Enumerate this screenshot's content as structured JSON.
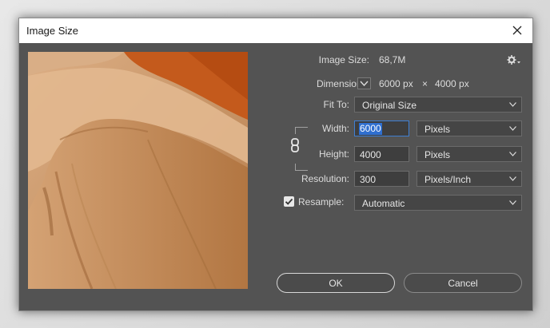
{
  "window": {
    "title": "Image Size"
  },
  "info": {
    "image_size_label": "Image Size:",
    "image_size_value": "68,7M",
    "dimensions_label": "Dimensions:",
    "dimensions_width": "6000 px",
    "dimensions_sep": "×",
    "dimensions_height": "4000 px"
  },
  "fit_to": {
    "label": "Fit To:",
    "value": "Original Size"
  },
  "width": {
    "label": "Width:",
    "value": "6000",
    "unit": "Pixels"
  },
  "height": {
    "label": "Height:",
    "value": "4000",
    "unit": "Pixels"
  },
  "resolution": {
    "label": "Resolution:",
    "value": "300",
    "unit": "Pixels/Inch"
  },
  "resample": {
    "label": "Resample:",
    "checked": true,
    "value": "Automatic"
  },
  "buttons": {
    "ok": "OK",
    "cancel": "Cancel"
  },
  "icons": {
    "close": "close-icon",
    "settings": "gear-icon",
    "link": "chain-link-icon",
    "dimensions_toggle": "chevron-down-icon"
  },
  "colors": {
    "dialog_bg": "#535353",
    "selection": "#2f6fd0"
  }
}
